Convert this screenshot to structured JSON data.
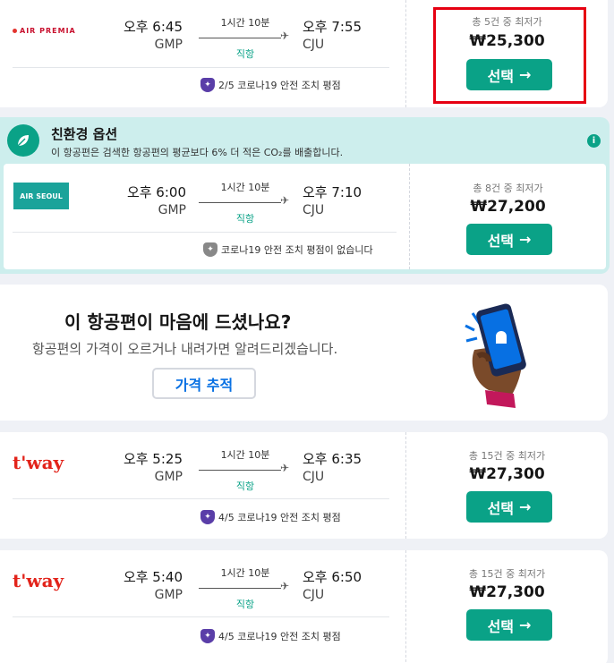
{
  "flights": [
    {
      "airline": "AIR PREMIA",
      "dep_time": "오후 6:45",
      "dep_airport": "GMP",
      "duration": "1시간 10분",
      "stops": "직항",
      "arr_time": "오후 7:55",
      "arr_airport": "CJU",
      "safety_text": "2/5 코로나19 안전 조치 평점",
      "count_text": "총 5건 중 최저가",
      "price": "₩25,300",
      "select_label": "선택"
    },
    {
      "airline": "AIR SEOUL",
      "dep_time": "오후 6:00",
      "dep_airport": "GMP",
      "duration": "1시간 10분",
      "stops": "직항",
      "arr_time": "오후 7:10",
      "arr_airport": "CJU",
      "safety_text": "코로나19 안전 조치 평점이 없습니다",
      "count_text": "총 8건 중 최저가",
      "price": "₩27,200",
      "select_label": "선택"
    },
    {
      "airline": "t'way",
      "dep_time": "오후 5:25",
      "dep_airport": "GMP",
      "duration": "1시간 10분",
      "stops": "직항",
      "arr_time": "오후 6:35",
      "arr_airport": "CJU",
      "safety_text": "4/5 코로나19 안전 조치 평점",
      "count_text": "총 15건 중 최저가",
      "price": "₩27,300",
      "select_label": "선택"
    },
    {
      "airline": "t'way",
      "dep_time": "오후 5:40",
      "dep_airport": "GMP",
      "duration": "1시간 10분",
      "stops": "직항",
      "arr_time": "오후 6:50",
      "arr_airport": "CJU",
      "safety_text": "4/5 코로나19 안전 조치 평점",
      "count_text": "총 15건 중 최저가",
      "price": "₩27,300",
      "select_label": "선택"
    }
  ],
  "eco": {
    "title": "친환경 옵션",
    "desc": "이 항공편은 검색한 항공편의 평균보다 6% 더 적은 CO₂를 배출합니다."
  },
  "promo": {
    "title": "이 항공편이 마음에 드셨나요?",
    "subtitle": "항공편의 가격이 오르거나 내려가면 알려드리겠습니다.",
    "button": "가격 추적"
  },
  "colors": {
    "accent": "#0aa287",
    "eco_bg": "#cdeeed",
    "highlight": "#e60012",
    "link": "#0770e3"
  }
}
